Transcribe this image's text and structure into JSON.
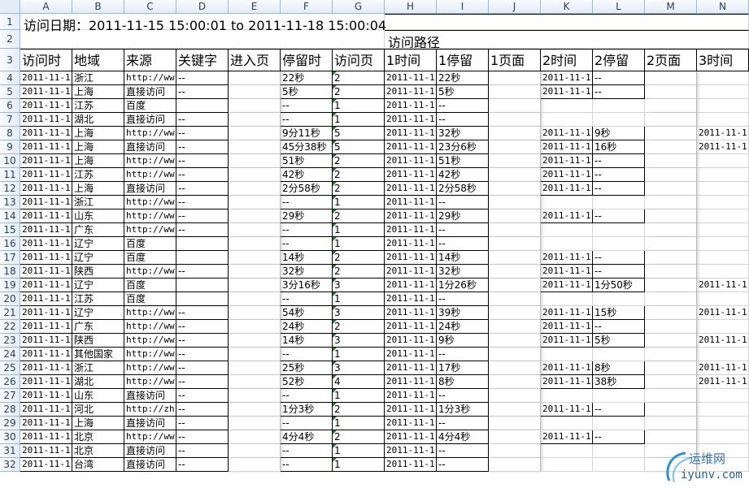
{
  "sheet": {
    "columns": [
      "A",
      "B",
      "C",
      "D",
      "E",
      "F",
      "G",
      "H",
      "I",
      "J",
      "K",
      "L",
      "M",
      "N"
    ],
    "row_numbers": [
      "1",
      "2",
      "3",
      "4",
      "5",
      "6",
      "7",
      "8",
      "9",
      "10",
      "11",
      "12",
      "13",
      "14",
      "15",
      "16",
      "17",
      "18",
      "19",
      "20",
      "21",
      "22",
      "23",
      "24",
      "25",
      "26",
      "27",
      "28",
      "29",
      "30",
      "31",
      "32"
    ],
    "title": "访问日期：2011-11-15 15:00:01 to 2011-11-18 15:00:04",
    "path_label": "访问路径",
    "headers": [
      "访问时",
      "地域",
      "来源",
      "关键字",
      "进入页",
      "停留时",
      "访问页",
      "1时间",
      "1停留",
      "1页面",
      "2时间",
      "2停留",
      "2页面",
      "3时间"
    ],
    "rows": [
      [
        "2011-11-1",
        "浙江",
        "http://ww",
        "--",
        "",
        "22秒",
        "2",
        "2011-11-1",
        "22秒",
        "",
        "2011-11-1",
        "--",
        "",
        ""
      ],
      [
        "2011-11-1",
        "上海",
        "直接访问",
        "--",
        "",
        "5秒",
        "2",
        "2011-11-1",
        "5秒",
        "",
        "2011-11-1",
        "--",
        "",
        ""
      ],
      [
        "2011-11-1",
        "江苏",
        "百度",
        "",
        "",
        "--",
        "1",
        "2011-11-1",
        "--",
        "",
        "",
        "",
        "",
        ""
      ],
      [
        "2011-11-1",
        "湖北",
        "直接访问",
        "--",
        "",
        "--",
        "1",
        "2011-11-1",
        "--",
        "",
        "",
        "",
        "",
        ""
      ],
      [
        "2011-11-1",
        "上海",
        "http://ww",
        "--",
        "",
        "9分11秒",
        "5",
        "2011-11-1",
        "32秒",
        "",
        "2011-11-1",
        "9秒",
        "",
        "2011-11-1"
      ],
      [
        "2011-11-1",
        "上海",
        "直接访问",
        "--",
        "",
        "45分38秒",
        "5",
        "2011-11-1",
        "23分6秒",
        "",
        "2011-11-1",
        "16秒",
        "",
        "2011-11-1"
      ],
      [
        "2011-11-1",
        "上海",
        "http://ww",
        "--",
        "",
        "51秒",
        "2",
        "2011-11-1",
        "51秒",
        "",
        "2011-11-1",
        "--",
        "",
        ""
      ],
      [
        "2011-11-1",
        "江苏",
        "http://ww",
        "--",
        "",
        "42秒",
        "2",
        "2011-11-1",
        "42秒",
        "",
        "2011-11-1",
        "--",
        "",
        ""
      ],
      [
        "2011-11-1",
        "上海",
        "直接访问",
        "--",
        "",
        "2分58秒",
        "2",
        "2011-11-1",
        "2分58秒",
        "",
        "2011-11-1",
        "--",
        "",
        ""
      ],
      [
        "2011-11-1",
        "浙江",
        "http://ww",
        "--",
        "",
        "--",
        "1",
        "2011-11-1",
        "--",
        "",
        "",
        "",
        "",
        ""
      ],
      [
        "2011-11-1",
        "山东",
        "http://ww",
        "--",
        "",
        "29秒",
        "2",
        "2011-11-1",
        "29秒",
        "",
        "2011-11-1",
        "--",
        "",
        ""
      ],
      [
        "2011-11-1",
        "广东",
        "http://ww",
        "--",
        "",
        "--",
        "1",
        "2011-11-1",
        "--",
        "",
        "",
        "",
        "",
        ""
      ],
      [
        "2011-11-1",
        "辽宁",
        "百度",
        "",
        "",
        "--",
        "1",
        "2011-11-1",
        "--",
        "",
        "",
        "",
        "",
        ""
      ],
      [
        "2011-11-1",
        "辽宁",
        "百度",
        "",
        "",
        "14秒",
        "2",
        "2011-11-1",
        "14秒",
        "",
        "2011-11-1",
        "--",
        "",
        ""
      ],
      [
        "2011-11-1",
        "陕西",
        "http://ww",
        "--",
        "",
        "32秒",
        "2",
        "2011-11-1",
        "32秒",
        "",
        "2011-11-1",
        "--",
        "",
        ""
      ],
      [
        "2011-11-1",
        "辽宁",
        "百度",
        "",
        "",
        "3分16秒",
        "3",
        "2011-11-1",
        "1分26秒",
        "",
        "2011-11-1",
        "1分50秒",
        "",
        "2011-11-1"
      ],
      [
        "2011-11-1",
        "江苏",
        "百度",
        "",
        "",
        "--",
        "1",
        "2011-11-1",
        "--",
        "",
        "",
        "",
        "",
        ""
      ],
      [
        "2011-11-1",
        "辽宁",
        "http://ww",
        "--",
        "",
        "54秒",
        "3",
        "2011-11-1",
        "39秒",
        "",
        "2011-11-1",
        "15秒",
        "",
        "2011-11-1"
      ],
      [
        "2011-11-1",
        "广东",
        "http://ww",
        "--",
        "",
        "24秒",
        "2",
        "2011-11-1",
        "24秒",
        "",
        "2011-11-1",
        "--",
        "",
        ""
      ],
      [
        "2011-11-1",
        "陕西",
        "http://ww",
        "--",
        "",
        "14秒",
        "3",
        "2011-11-1",
        "9秒",
        "",
        "2011-11-1",
        "5秒",
        "",
        "2011-11-1"
      ],
      [
        "2011-11-1",
        "其他国家",
        "http://ww",
        "--",
        "",
        "--",
        "1",
        "2011-11-1",
        "--",
        "",
        "",
        "",
        "",
        ""
      ],
      [
        "2011-11-1",
        "浙江",
        "http://ww",
        "--",
        "",
        "25秒",
        "3",
        "2011-11-1",
        "17秒",
        "",
        "2011-11-1",
        "8秒",
        "",
        "2011-11-1"
      ],
      [
        "2011-11-1",
        "湖北",
        "http://ww",
        "--",
        "",
        "52秒",
        "4",
        "2011-11-1",
        "8秒",
        "",
        "2011-11-1",
        "38秒",
        "",
        "2011-11-1"
      ],
      [
        "2011-11-1",
        "山东",
        "直接访问",
        "--",
        "",
        "--",
        "1",
        "2011-11-1",
        "--",
        "",
        "",
        "",
        "",
        ""
      ],
      [
        "2011-11-1",
        "河北",
        "http://zh",
        "--",
        "",
        "1分3秒",
        "2",
        "2011-11-1",
        "1分3秒",
        "",
        "2011-11-1",
        "--",
        "",
        ""
      ],
      [
        "2011-11-1",
        "上海",
        "直接访问",
        "--",
        "",
        "--",
        "1",
        "2011-11-1",
        "--",
        "",
        "",
        "",
        "",
        ""
      ],
      [
        "2011-11-1",
        "北京",
        "http://ww",
        "--",
        "",
        "4分4秒",
        "2",
        "2011-11-1",
        "4分4秒",
        "",
        "2011-11-1",
        "--",
        "",
        ""
      ],
      [
        "2011-11-1",
        "北京",
        "直接访问",
        "--",
        "",
        "--",
        "1",
        "2011-11-1",
        "--",
        "",
        "",
        "",
        "",
        ""
      ],
      [
        "2011-11-1",
        "台湾",
        "直接访问",
        "--",
        "",
        "--",
        "1",
        "2011-11-1",
        "--",
        "",
        "",
        "",
        "",
        ""
      ]
    ]
  },
  "watermark": {
    "name": "运维网",
    "domain": "iyunv.com"
  },
  "colors": {
    "header_bg": "#e4ecf7",
    "header_text": "#27415f",
    "grid_line": "#d4d4d4",
    "flag": "#1a7a1a"
  }
}
